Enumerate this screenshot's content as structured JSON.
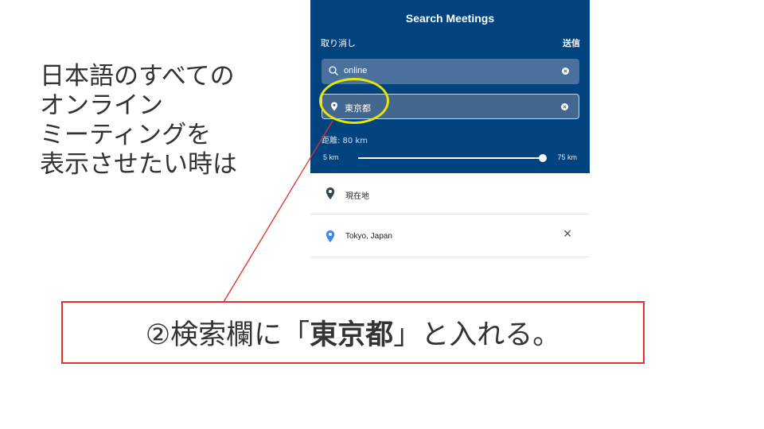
{
  "intro": {
    "lines": [
      "日本語のすべての",
      "オンライン",
      "ミーティングを",
      "表示させたい時は"
    ]
  },
  "app": {
    "title": "Search Meetings",
    "cancel_label": "取り消し",
    "send_label": "送信",
    "search": {
      "value": "online",
      "icon": "search-icon",
      "clear_icon": "clear-icon"
    },
    "location": {
      "value": "東京都",
      "icon": "location-pin-icon",
      "clear_icon": "clear-icon"
    },
    "distance": {
      "label": "距離: 80 km",
      "min_label": "5 km",
      "max_label": "75 km",
      "min": 5,
      "max": 75,
      "value": 75
    },
    "suggestions": [
      {
        "label": "現在地",
        "icon": "location-pin-icon",
        "icon_color": "#37474f"
      },
      {
        "label": "Tokyo, Japan",
        "icon": "location-pin-icon",
        "icon_color": "#4285f4",
        "remove_label": "✕"
      }
    ],
    "colors": {
      "panel": "#00437e",
      "field": "#4a719d"
    }
  },
  "annotation": {
    "circle_color": "#e6e600",
    "line_color": "#e03030",
    "callout_prefix": "②検索欄に「",
    "callout_emphasis": "東京都",
    "callout_suffix": "」と入れる。",
    "callout_border_color": "#e03030"
  }
}
